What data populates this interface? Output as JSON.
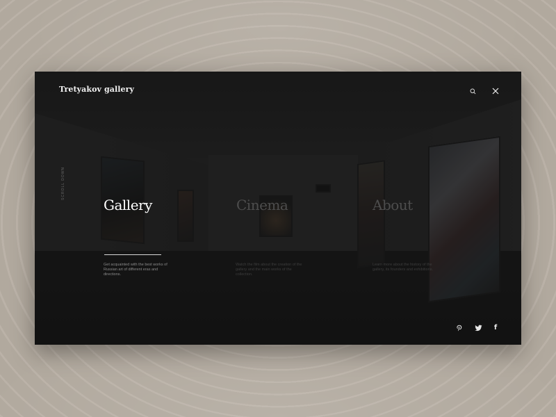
{
  "brand": {
    "title": "Tretyakov gallery"
  },
  "side_label": "SCROLL DOWN",
  "menu": {
    "items": [
      {
        "label": "Gallery",
        "description": "Get acquainted with the best works of Russian art of different eras and directions."
      },
      {
        "label": "Cinema",
        "description": "Watch the film about the creation of the gallery and the main works of the collection."
      },
      {
        "label": "About",
        "description": "Learn more about the history of the gallery, its founders and exhibitions."
      }
    ]
  },
  "header": {
    "search_icon": "search-icon",
    "close_icon": "close-icon"
  },
  "social": {
    "pinterest_icon": "pinterest-icon",
    "twitter_icon": "twitter-icon",
    "facebook_icon": "facebook-icon",
    "facebook_glyph": "f"
  },
  "colors": {
    "background": "#b7aea3",
    "window": "#1e1e1e",
    "active_text": "#ffffff",
    "inactive_text": "#4d4d4d"
  }
}
